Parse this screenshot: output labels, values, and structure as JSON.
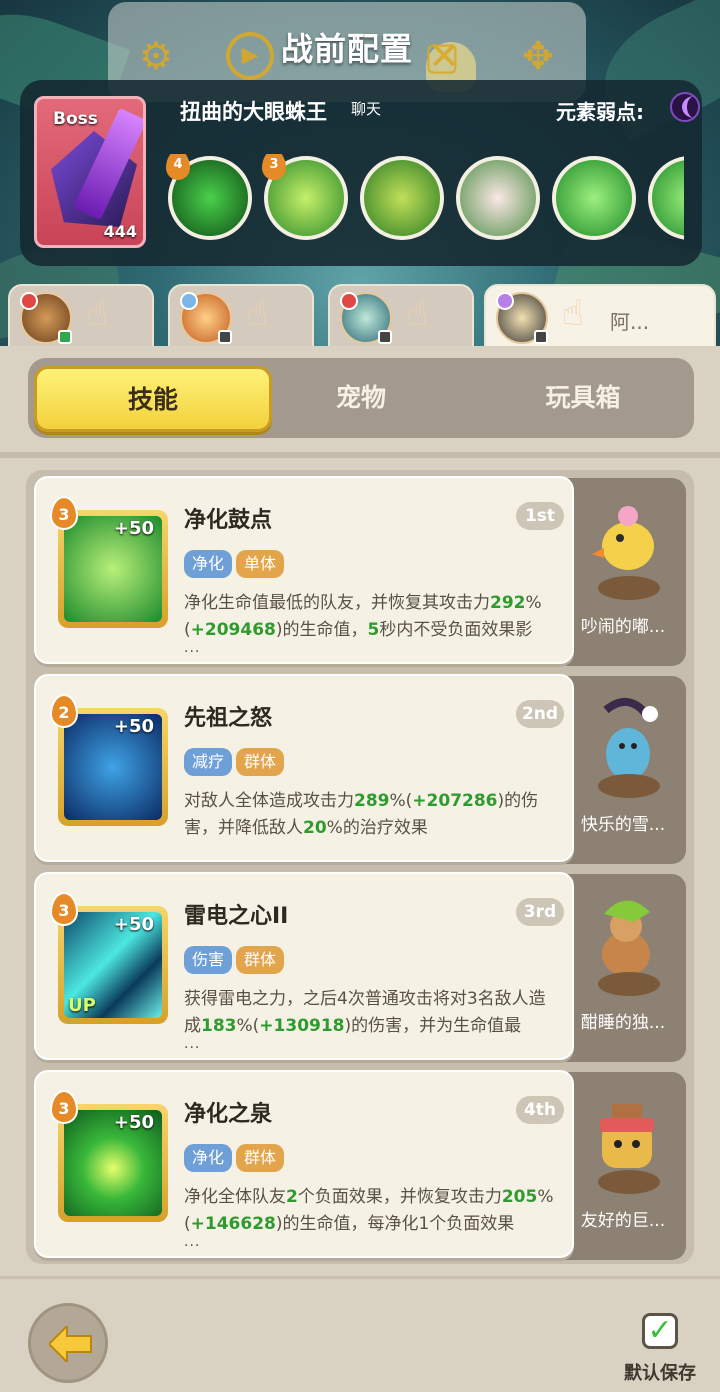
{
  "window": {
    "title": "战前配置"
  },
  "boss": {
    "tag": "Boss",
    "level": "444",
    "name": "扭曲的大眼蛛王",
    "chat": "聊天",
    "weakness_label": "元素弱点:",
    "skill_badges": [
      "4",
      "3"
    ]
  },
  "heroes": [
    {
      "name": ""
    },
    {
      "name": ""
    },
    {
      "name": ""
    },
    {
      "name": "阿..."
    }
  ],
  "tabs": [
    "技能",
    "宠物",
    "玩具箱"
  ],
  "skills": [
    {
      "level": "3",
      "plus": "+50",
      "up": "",
      "name": "净化鼓点",
      "rank": "1st",
      "tag1": "净化",
      "tag2": "单体",
      "desc_parts": [
        "净化生命值最低的队友，并恢复其攻击力",
        "292",
        "%(",
        "+209468",
        ")的生命值，",
        "5",
        "秒内不受负面效果影"
      ],
      "more": "...",
      "pet_name": "吵闹的嘟..."
    },
    {
      "level": "2",
      "plus": "+50",
      "up": "",
      "name": "先祖之怒",
      "rank": "2nd",
      "tag1": "减疗",
      "tag2": "群体",
      "desc_parts": [
        "对敌人全体造成攻击力",
        "289",
        "%(",
        "+207286",
        ")的伤害，并降低敌人",
        "20",
        "%的治疗效果"
      ],
      "more": "",
      "pet_name": "快乐的雪..."
    },
    {
      "level": "3",
      "plus": "+50",
      "up": "UP",
      "name": "雷电之心II",
      "rank": "3rd",
      "tag1": "伤害",
      "tag2": "群体",
      "desc_parts": [
        "获得雷电之力，之后4次普通攻击将对3名敌人造成",
        "183",
        "%(",
        "+130918",
        ")的伤害，并为生命值最",
        "",
        ""
      ],
      "more": "...",
      "pet_name": "酣睡的独..."
    },
    {
      "level": "3",
      "plus": "+50",
      "up": "",
      "name": "净化之泉",
      "rank": "4th",
      "tag1": "净化",
      "tag2": "群体",
      "desc_parts": [
        "净化全体队友",
        "2",
        "个负面效果，并恢复攻击力",
        "205",
        "%(",
        "+146628",
        ")的生命值，每净化1个负面效果"
      ],
      "more": "...",
      "pet_name": "友好的巨..."
    }
  ],
  "footer": {
    "save_label": "默认保存",
    "save_checked": "✓"
  }
}
